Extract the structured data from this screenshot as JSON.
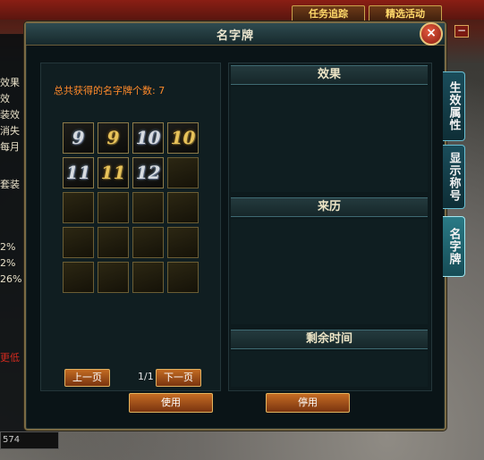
{
  "top_buttons": {
    "quest_tracking": "任务追踪",
    "other": "精选活动"
  },
  "window": {
    "title": "名字牌",
    "close_label": "×"
  },
  "left_sidebar": {
    "lines": [
      "效果",
      "效",
      "装效",
      "消失",
      "每月",
      "套装"
    ],
    "percent_lines": [
      "2%",
      "2%",
      "26%"
    ],
    "red_line": "更低",
    "bottom_value": "574"
  },
  "name_cards": {
    "count_label": "总共获得的名字牌个数: 7",
    "cards": [
      {
        "glyph": "9",
        "tone": "silver"
      },
      {
        "glyph": "9",
        "tone": "gold"
      },
      {
        "glyph": "10",
        "tone": "silver"
      },
      {
        "glyph": "10",
        "tone": "gold"
      },
      {
        "glyph": "11",
        "tone": "silver"
      },
      {
        "glyph": "11",
        "tone": "gold"
      },
      {
        "glyph": "12",
        "tone": "silver"
      }
    ],
    "total_slots": 20,
    "prev_page": "上一页",
    "next_page": "下一页",
    "page_indicator": "1/1"
  },
  "detail": {
    "effect_header": "效果",
    "source_header": "来历",
    "remaining_header": "剩余时间"
  },
  "actions": {
    "use": "使用",
    "disable": "停用"
  },
  "side_tabs": [
    {
      "label": "生效属性",
      "active": false
    },
    {
      "label": "显示称号",
      "active": false
    },
    {
      "label": "名字牌",
      "active": true
    }
  ]
}
